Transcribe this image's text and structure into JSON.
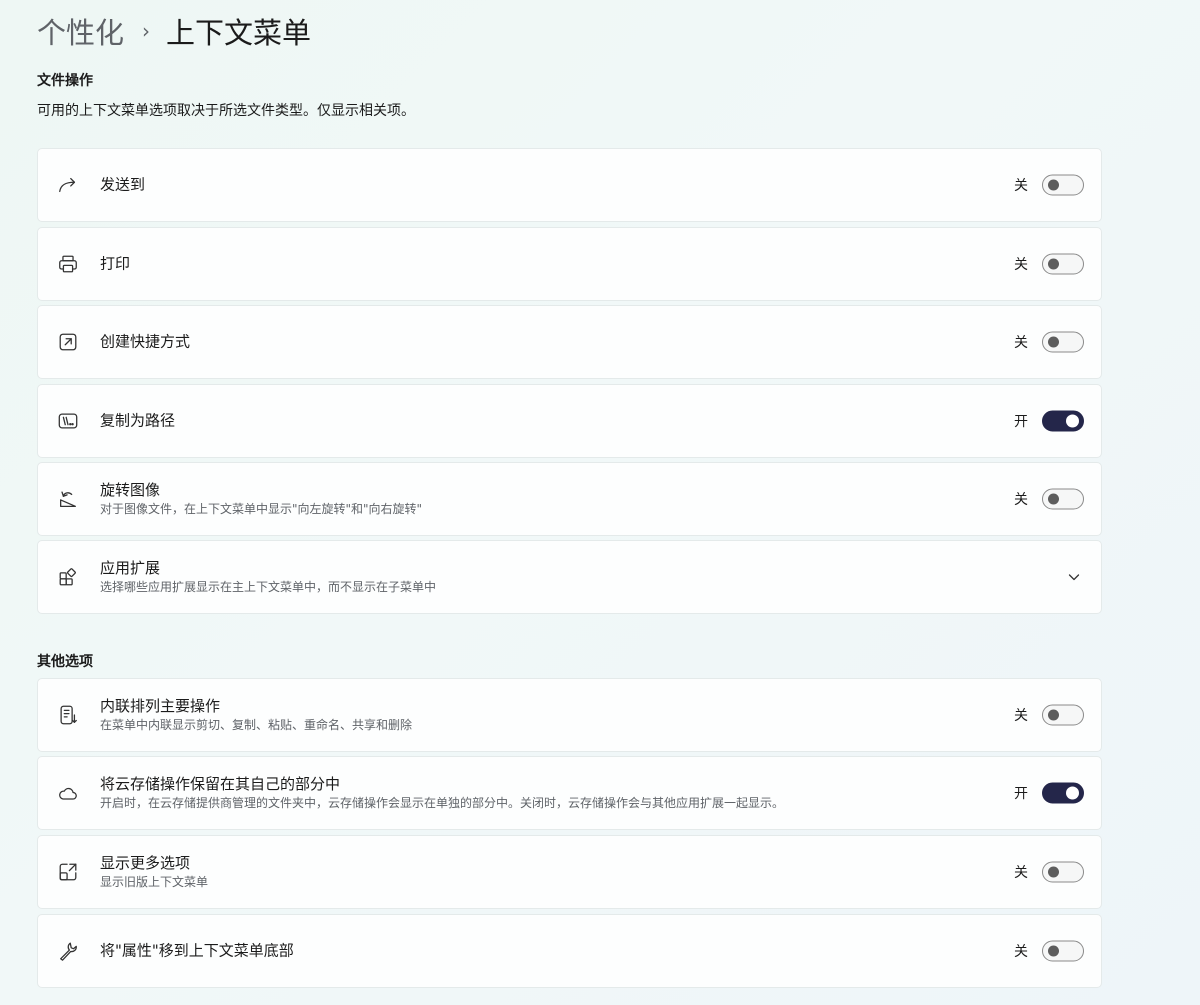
{
  "breadcrumb": {
    "parent": "个性化",
    "separator": "›",
    "current": "上下文菜单"
  },
  "file_ops": {
    "title": "文件操作",
    "description": "可用的上下文菜单选项取决于所选文件类型。仅显示相关项。",
    "items": [
      {
        "label": "发送到",
        "state": "关",
        "on": false,
        "icon": "share-arrow-icon"
      },
      {
        "label": "打印",
        "state": "关",
        "on": false,
        "icon": "printer-icon"
      },
      {
        "label": "创建快捷方式",
        "state": "关",
        "on": false,
        "icon": "shortcut-icon"
      },
      {
        "label": "复制为路径",
        "state": "开",
        "on": true,
        "icon": "path-icon"
      },
      {
        "label": "旋转图像",
        "sub": "对于图像文件，在上下文菜单中显示\"向左旋转\"和\"向右旋转\"",
        "state": "关",
        "on": false,
        "icon": "rotate-image-icon"
      },
      {
        "label": "应用扩展",
        "sub": "选择哪些应用扩展显示在主上下文菜单中，而不显示在子菜单中",
        "icon": "app-extensions-icon"
      }
    ]
  },
  "other": {
    "title": "其他选项",
    "items": [
      {
        "label": "内联排列主要操作",
        "sub": "在菜单中内联显示剪切、复制、粘贴、重命名、共享和删除",
        "state": "关",
        "on": false,
        "icon": "inline-list-icon"
      },
      {
        "label": "将云存储操作保留在其自己的部分中",
        "sub": "开启时，在云存储提供商管理的文件夹中，云存储操作会显示在单独的部分中。关闭时，云存储操作会与其他应用扩展一起显示。",
        "state": "开",
        "on": true,
        "icon": "cloud-icon"
      },
      {
        "label": "显示更多选项",
        "sub": "显示旧版上下文菜单",
        "state": "关",
        "on": false,
        "icon": "more-options-icon"
      },
      {
        "label": "将\"属性\"移到上下文菜单底部",
        "state": "关",
        "on": false,
        "icon": "wrench-icon"
      }
    ]
  },
  "colors": {
    "toggle_on": "#24264a",
    "toggle_off_knob": "#5d5d5d"
  }
}
